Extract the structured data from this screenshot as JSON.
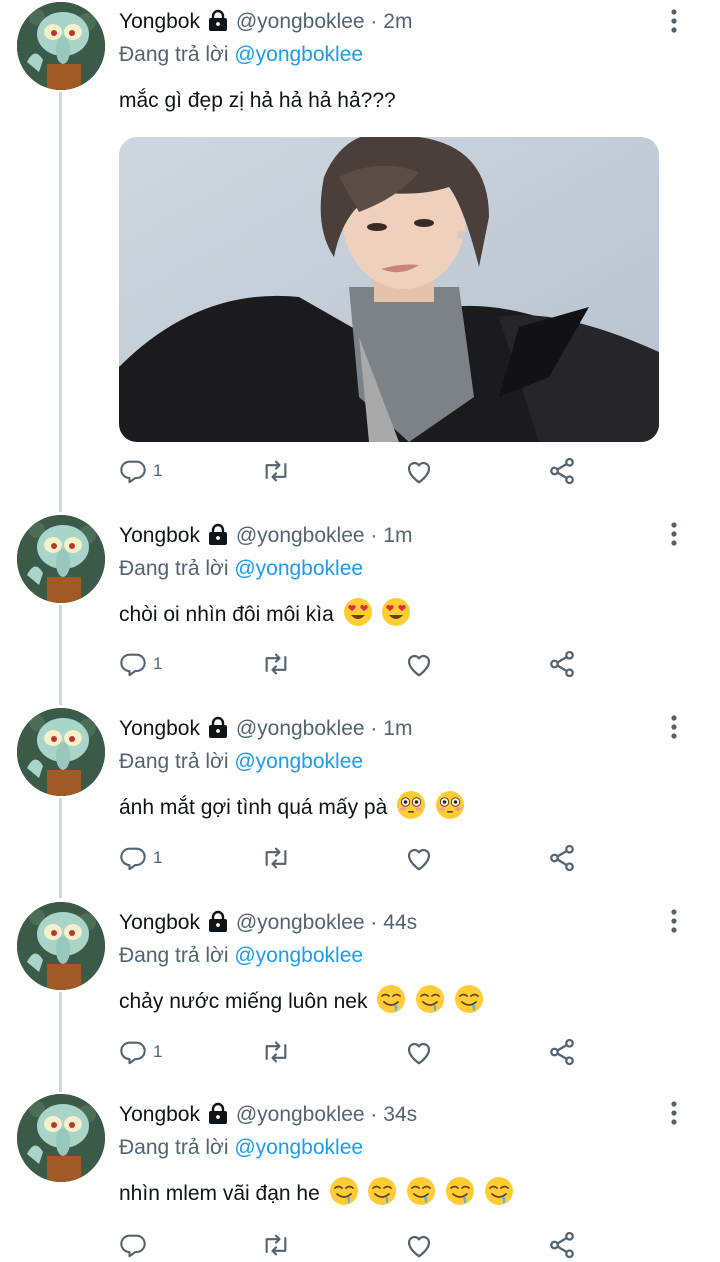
{
  "tweets": [
    {
      "name": "Yongbok",
      "handle": "@yongboklee",
      "time": "2m",
      "replying_prefix": "Đang trả lời",
      "replying_to": "@yongboklee",
      "text": "mắc gì đẹp zị hả hả hả hả???",
      "reply_count": "1",
      "emojis": []
    },
    {
      "name": "Yongbok",
      "handle": "@yongboklee",
      "time": "1m",
      "replying_prefix": "Đang trả lời",
      "replying_to": "@yongboklee",
      "text": "chòi oi nhìn đôi môi kìa",
      "reply_count": "1",
      "emojis": [
        "heart-eyes-emoji",
        "heart-eyes-emoji"
      ]
    },
    {
      "name": "Yongbok",
      "handle": "@yongboklee",
      "time": "1m",
      "replying_prefix": "Đang trả lời",
      "replying_to": "@yongboklee",
      "text": "ánh mắt gợi tình quá mấy pà",
      "reply_count": "1",
      "emojis": [
        "flushed-emoji",
        "flushed-emoji"
      ]
    },
    {
      "name": "Yongbok",
      "handle": "@yongboklee",
      "time": "44s",
      "replying_prefix": "Đang trả lời",
      "replying_to": "@yongboklee",
      "text": "chảy nước miếng luôn nek",
      "reply_count": "1",
      "emojis": [
        "drooling-emoji",
        "drooling-emoji",
        "drooling-emoji"
      ]
    },
    {
      "name": "Yongbok",
      "handle": "@yongboklee",
      "time": "34s",
      "replying_prefix": "Đang trả lời",
      "replying_to": "@yongboklee",
      "text": "nhìn mlem vãi đạn he",
      "reply_count": "",
      "emojis": [
        "drooling-emoji",
        "drooling-emoji",
        "drooling-emoji",
        "drooling-emoji",
        "drooling-emoji"
      ]
    }
  ],
  "colors": {
    "text_primary": "#0f1419",
    "text_secondary": "#536471",
    "link": "#1d9bf0",
    "thread_line": "#cfd9de"
  },
  "separator": "·"
}
